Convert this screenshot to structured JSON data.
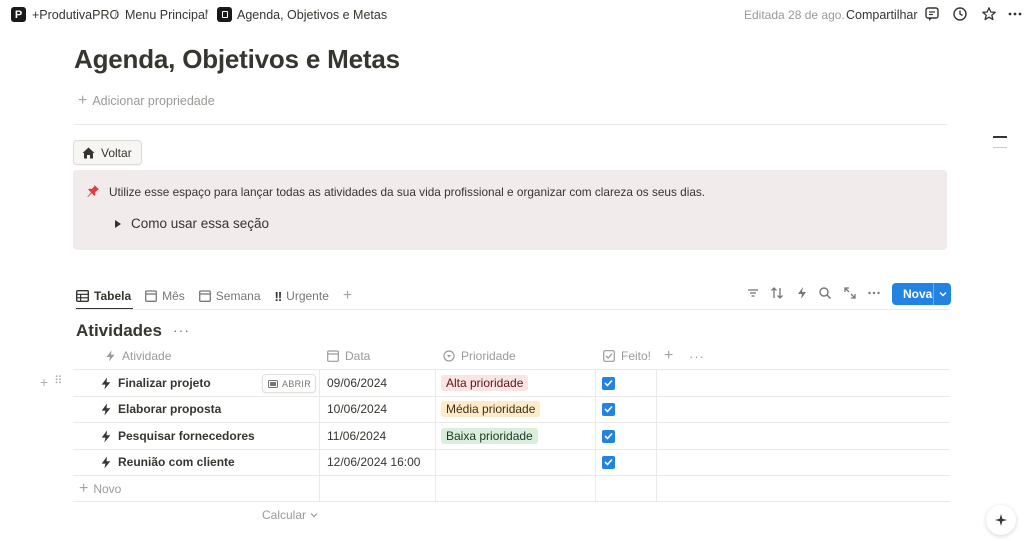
{
  "topbar": {
    "workspace_logo": "P",
    "crumbs": [
      "+ProdutivaPRO",
      "Menu Principal",
      "Agenda, Objetivos e Metas"
    ],
    "separator": "/",
    "edited": "Editada 28 de ago.",
    "share_label": "Compartilhar",
    "icons": [
      "comment-icon",
      "history-icon",
      "star-icon",
      "more-icon"
    ]
  },
  "page": {
    "title": "Agenda, Objetivos e Metas",
    "add_property": "Adicionar propriedade"
  },
  "back_button": {
    "label": "Voltar",
    "icon": "home-icon"
  },
  "callout": {
    "icon": "pushpin-icon",
    "text": "Utilize esse espaço para lançar todas as atividades da sua vida profissional e organizar com clareza os seus dias.",
    "toggle_label": "Como usar essa seção"
  },
  "views": {
    "tabs": [
      {
        "label": "Tabela",
        "icon": "table-icon",
        "active": true
      },
      {
        "label": "Mês",
        "icon": "calendar-icon",
        "active": false
      },
      {
        "label": "Semana",
        "icon": "calendar-icon",
        "active": false
      },
      {
        "label": "Urgente",
        "icon": "double-exclamation-icon",
        "active": false
      }
    ],
    "new_button": "Nova"
  },
  "database": {
    "title": "Atividades",
    "columns": [
      "Atividade",
      "Data",
      "Prioridade",
      "Feito!"
    ],
    "open_label": "ABRIR",
    "rows": [
      {
        "name": "Finalizar projeto",
        "date": "09/06/2024",
        "priority": "Alta prioridade",
        "priority_color": "#fbe4e4",
        "priority_text_color": "#5d1715",
        "done": true
      },
      {
        "name": "Elaborar proposta",
        "date": "10/06/2024",
        "priority": "Média prioridade",
        "priority_color": "#fdecc8",
        "priority_text_color": "#402c1b",
        "done": true
      },
      {
        "name": "Pesquisar fornecedores",
        "date": "11/06/2024",
        "priority": "Baixa prioridade",
        "priority_color": "#dbeddb",
        "priority_text_color": "#1c3829",
        "done": true
      },
      {
        "name": "Reunião com cliente",
        "date": "12/06/2024 16:00",
        "priority": "",
        "priority_color": "",
        "priority_text_color": "",
        "done": true
      }
    ],
    "new_row_label": "Novo",
    "calculate_label": "Calcular"
  },
  "colors": {
    "accent": "#2383e2",
    "callout_bg": "#f2ebeb"
  }
}
